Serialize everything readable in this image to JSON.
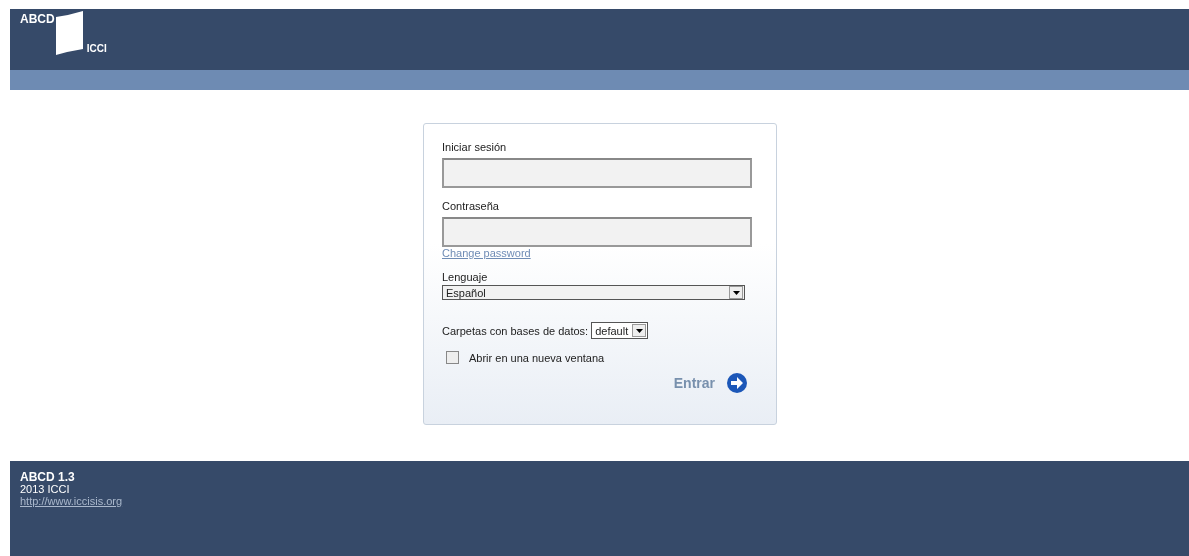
{
  "header": {
    "logo_text": "ABCD",
    "logo_sub": "ICCI"
  },
  "login": {
    "user_label": "Iniciar sesión",
    "password_label": "Contraseña",
    "change_password_link": "Change password",
    "language_label": "Lenguaje",
    "language_value": "Español",
    "folders_label": "Carpetas con bases de datos:",
    "folders_value": "default",
    "new_window": {
      "label": "Abrir en una nueva ventana",
      "checked": false
    },
    "submit": "Entrar"
  },
  "footer": {
    "version": "ABCD 1.3",
    "copyright": "2013 ICCI",
    "link": "http://www.iccisis.org"
  }
}
